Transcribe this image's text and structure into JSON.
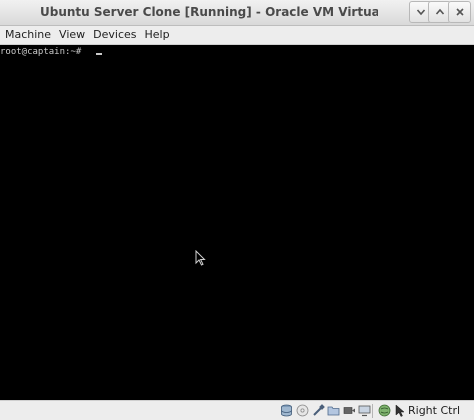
{
  "window": {
    "title": "Ubuntu Server Clone [Running] - Oracle VM VirtualBox"
  },
  "menubar": {
    "items": [
      "Machine",
      "View",
      "Devices",
      "Help"
    ]
  },
  "console": {
    "prompt": "root@captain:~# "
  },
  "statusbar": {
    "icons": [
      "hard-disk-icon",
      "optical-disk-icon",
      "usb-icon",
      "shared-folders-icon",
      "network-icon",
      "video-capture-icon",
      "mouse-integration-icon",
      "host-key-arrow-icon"
    ],
    "host_key": "Right Ctrl"
  }
}
